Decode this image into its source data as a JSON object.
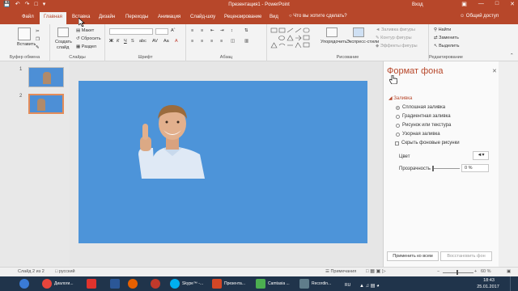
{
  "window": {
    "title": "Презентация1 - PowerPoint",
    "login": "Вход"
  },
  "tabs": [
    {
      "label": "Файл",
      "active": false
    },
    {
      "label": "Главная",
      "active": true
    },
    {
      "label": "Вставка",
      "active": false
    },
    {
      "label": "Дизайн",
      "active": false
    },
    {
      "label": "Переходы",
      "active": false
    },
    {
      "label": "Анимация",
      "active": false
    },
    {
      "label": "Слайд-шоу",
      "active": false
    },
    {
      "label": "Рецензирование",
      "active": false
    },
    {
      "label": "Вид",
      "active": false
    }
  ],
  "tellme": "Что вы хотите сделать?",
  "share": "Общий доступ",
  "ribbon": {
    "clipboard": {
      "paste": "Вставить",
      "label": "Буфер обмена"
    },
    "slides": {
      "create": "Создать",
      "create2": "слайд",
      "layout": "Макет",
      "reset": "Сбросить",
      "section": "Раздел",
      "label": "Слайды"
    },
    "font": {
      "label": "Шрифт"
    },
    "paragraph": {
      "label": "Абзац"
    },
    "drawing": {
      "arrange": "Упорядочить",
      "quick_styles": "Экспресс-стили",
      "fill": "Заливка фигуры",
      "outline": "Контур фигуры",
      "effects": "Эффекты фигуры",
      "label": "Рисование"
    },
    "editing": {
      "find": "Найти",
      "replace": "Заменить",
      "select": "Выделить",
      "label": "Редактирование"
    }
  },
  "slides": [
    {
      "number": "1",
      "selected": false
    },
    {
      "number": "2",
      "selected": true
    }
  ],
  "format_pane": {
    "title": "Формат фона",
    "section": "Заливка",
    "options": [
      {
        "label": "Сплошная заливка",
        "checked": true
      },
      {
        "label": "Градиентная заливка",
        "checked": false
      },
      {
        "label": "Рисунок или текстура",
        "checked": false
      },
      {
        "label": "Узорная заливка",
        "checked": false
      }
    ],
    "hide_bg": "Скрыть фоновые рисунки",
    "color_label": "Цвет",
    "transparency_label": "Прозрачность",
    "transparency_value": "0 %",
    "apply_all": "Применить ко всем",
    "reset_bg": "Восстановить фон"
  },
  "statusbar": {
    "slide": "Слайд 2 из 2",
    "lang": "русский",
    "notes": "Примечания",
    "zoom": "60 %"
  },
  "taskbar": {
    "items": [
      "Диалоги...",
      "Skype™ -...",
      "Презента...",
      "Camtasia ...",
      "Recordin..."
    ],
    "lang": "RU",
    "time": "18:43",
    "date": "25.01.2017"
  },
  "colors": {
    "accent": "#b7472a",
    "slide_bg": "#4d94d9",
    "taskbar": "#20344b"
  }
}
